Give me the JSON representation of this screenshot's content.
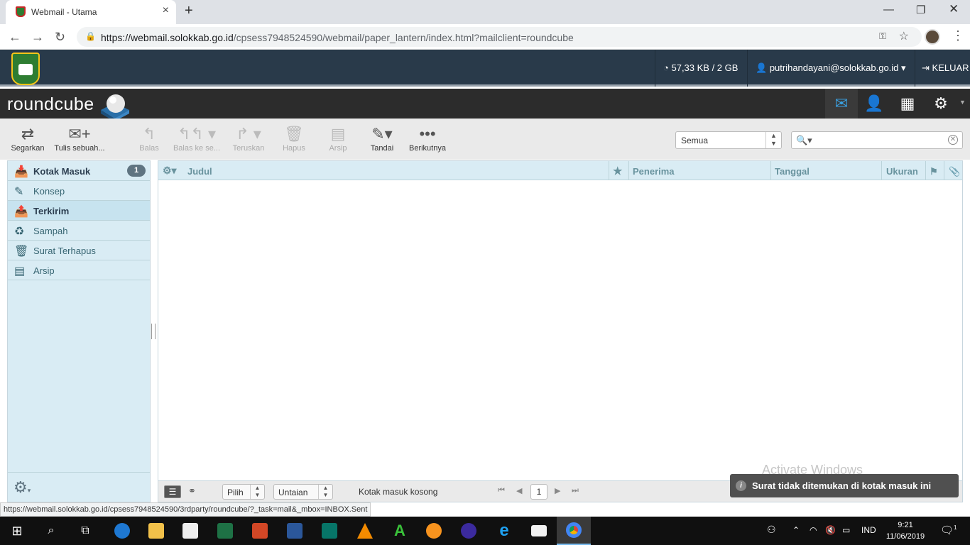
{
  "browser": {
    "tab_title": "Webmail - Utama",
    "url_host": "https://webmail.solokkab.go.id",
    "url_path": "/cpsess7948524590/webmail/paper_lantern/index.html?mailclient=roundcube",
    "status_link": "https://webmail.solokkab.go.id/cpsess7948524590/3rdparty/roundcube/?_task=mail&_mbox=INBOX.Sent"
  },
  "cpanel": {
    "quota": "57,33 KB / 2 GB",
    "user": "putrihandayani@solokkab.go.id",
    "logout": "KELUAR"
  },
  "roundcube": {
    "logo_text": "roundcube"
  },
  "toolbar": {
    "refresh": "Segarkan",
    "compose": "Tulis sebuah...",
    "reply": "Balas",
    "reply_all": "Balas ke se...",
    "forward": "Teruskan",
    "delete": "Hapus",
    "archive": "Arsip",
    "mark": "Tandai",
    "more": "Berikutnya",
    "filter_value": "Semua",
    "search_value": ""
  },
  "folders": [
    {
      "label": "Kotak Masuk",
      "unread": "1"
    },
    {
      "label": "Konsep"
    },
    {
      "label": "Terkirim"
    },
    {
      "label": "Sampah"
    },
    {
      "label": "Surat Terhapus"
    },
    {
      "label": "Arsip"
    }
  ],
  "messagelist": {
    "columns": {
      "subject": "Judul",
      "recipient": "Penerima",
      "date": "Tanggal",
      "size": "Ukuran"
    },
    "select_label": "Pilih",
    "threads_label": "Untaian",
    "empty_text": "Kotak masuk kosong",
    "page": "1"
  },
  "notification": "Surat tidak ditemukan di kotak masuk ini",
  "watermark": "Activate Windows",
  "taskbar": {
    "lang": "IND",
    "time": "9:21",
    "date": "11/06/2019",
    "notif_count": "1"
  },
  "colors": {
    "cpanel_bar": "#293a4a",
    "rc_header": "#2c2c2c",
    "folder_bg": "#d9ecf4",
    "accent": "#376572"
  }
}
